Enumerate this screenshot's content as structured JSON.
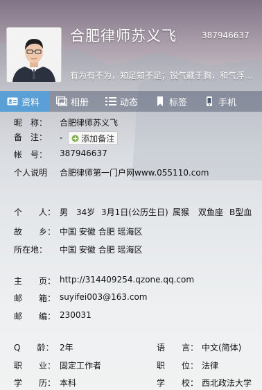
{
  "header": {
    "nickname": "合肥律师苏义飞",
    "qq_number": "387946637",
    "signature": "有为有不为，知足知不足；锐气藏于胸，和气浮..."
  },
  "tabs": [
    {
      "label": "资料",
      "icon": "profile-card-icon",
      "active": true
    },
    {
      "label": "相册",
      "icon": "photo-album-icon",
      "active": false
    },
    {
      "label": "动态",
      "icon": "list-icon",
      "active": false
    },
    {
      "label": "标签",
      "icon": "bookmark-icon",
      "active": false
    },
    {
      "label": "手机",
      "icon": "mobile-phone-icon",
      "active": false
    }
  ],
  "profile": {
    "nickname_label": "昵　称：",
    "nickname_value": "合肥律师苏义飞",
    "remark_label": "备　注：",
    "remark_value": "-",
    "add_remark_label": "添加备注",
    "account_label": "帐　号：",
    "account_value": "387946637",
    "personal_desc_label": "个人说明",
    "personal_desc_value": "合肥律师第一门户网www.055110.com",
    "personal_label": "个　　人：",
    "gender": "男",
    "age": "34岁",
    "birthday": "3月1日(公历生日)",
    "zodiac": "属猴",
    "constellation": "双鱼座",
    "blood_type": "B型血",
    "hometown_label": "故　　乡：",
    "hometown_value": "中国 安徽 合肥 瑶海区",
    "location_label": "所在地：",
    "location_value": "中国 安徽 合肥 瑶海区",
    "homepage_label": "主　　页：",
    "homepage_value": "http://314409254.qzone.qq.com",
    "email_label": "邮　　箱：",
    "email_value": "suyifei003@163.com",
    "zip_label": "邮　　编：",
    "zip_value": "230031",
    "qage_label": "Q　　龄：",
    "qage_value": "2年",
    "language_label": "语　　言：",
    "language_value": "中文(简体)",
    "job_label": "职　　业：",
    "job_value": "固定工作者",
    "position_label": "职　　位：",
    "position_value": "法律",
    "education_label": "学　　历：",
    "education_value": "本科",
    "school_label": "学　　校：",
    "school_value": "西北政法大学"
  },
  "colors": {
    "tab_active": "#5a9fd6",
    "tab_bar": "#4a5673"
  }
}
